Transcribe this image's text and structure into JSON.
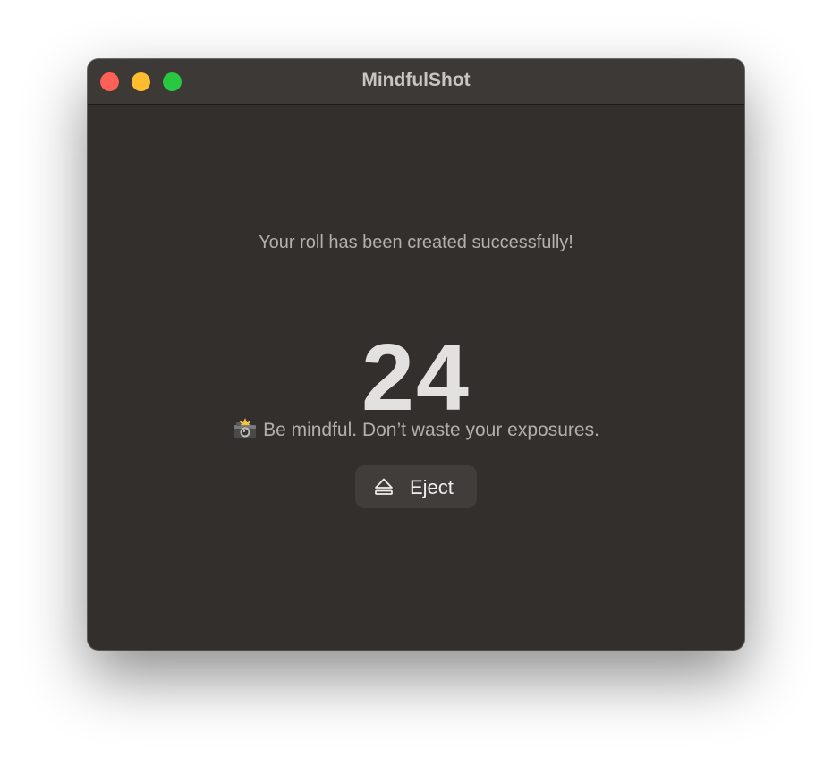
{
  "window": {
    "title": "MindfulShot"
  },
  "main": {
    "message": "Your roll has been created successfully!",
    "exposures_count": "24",
    "tagline": "Be mindful. Don’t waste your exposures.",
    "tagline_icon": "camera-with-flash-icon",
    "eject_label": "Eject",
    "eject_icon": "eject-icon"
  },
  "colors": {
    "window_bg": "#322f2d",
    "titlebar_bg": "#3c3937",
    "close": "#fe5f57",
    "minimize": "#febc2e",
    "zoom": "#28c840"
  }
}
